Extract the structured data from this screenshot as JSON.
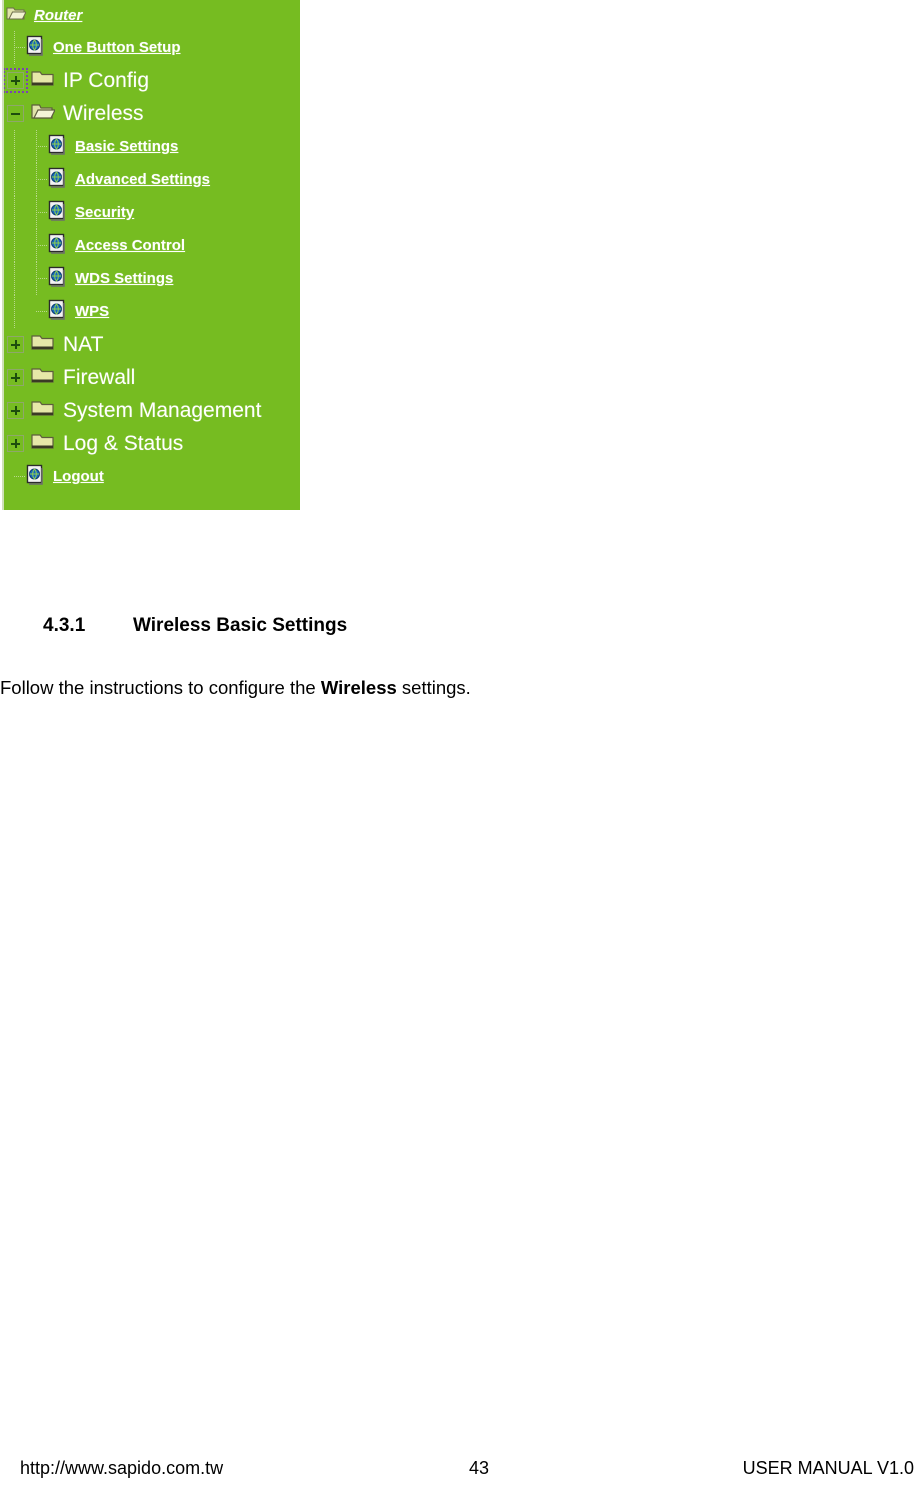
{
  "colors": {
    "nav_background": "#76bc21",
    "nav_label": "#ffffff",
    "page_background": "#ffffff",
    "text": "#000000",
    "focus_outline": "#7b42b5"
  },
  "nav_screenshot": {
    "root": {
      "label": "Router",
      "icon": "open-folder-icon"
    },
    "items": [
      {
        "label": "One Button Setup",
        "type": "link",
        "icon": "page-globe-icon",
        "depth": 1,
        "toggle": "none"
      },
      {
        "label": "IP Config",
        "type": "folder",
        "icon": "closed-folder-icon",
        "depth": 0,
        "toggle": "plus",
        "focused": true
      },
      {
        "label": "Wireless",
        "type": "folder",
        "icon": "open-folder-icon",
        "depth": 0,
        "toggle": "minus",
        "expanded": true
      },
      {
        "label": "Basic Settings",
        "type": "link",
        "icon": "page-globe-icon",
        "depth": 2,
        "toggle": "none"
      },
      {
        "label": "Advanced Settings",
        "type": "link",
        "icon": "page-globe-icon",
        "depth": 2,
        "toggle": "none"
      },
      {
        "label": "Security",
        "type": "link",
        "icon": "page-globe-icon",
        "depth": 2,
        "toggle": "none"
      },
      {
        "label": "Access Control",
        "type": "link",
        "icon": "page-globe-icon",
        "depth": 2,
        "toggle": "none"
      },
      {
        "label": "WDS Settings",
        "type": "link",
        "icon": "page-globe-icon",
        "depth": 2,
        "toggle": "none"
      },
      {
        "label": "WPS",
        "type": "link",
        "icon": "page-globe-icon",
        "depth": 2,
        "toggle": "none"
      },
      {
        "label": "NAT",
        "type": "folder",
        "icon": "closed-folder-icon",
        "depth": 0,
        "toggle": "plus"
      },
      {
        "label": "Firewall",
        "type": "folder",
        "icon": "closed-folder-icon",
        "depth": 0,
        "toggle": "plus"
      },
      {
        "label": "System Management",
        "type": "folder",
        "icon": "closed-folder-icon",
        "depth": 0,
        "toggle": "plus"
      },
      {
        "label": "Log & Status",
        "type": "folder",
        "icon": "closed-folder-icon",
        "depth": 0,
        "toggle": "plus"
      },
      {
        "label": "Logout",
        "type": "link",
        "icon": "page-globe-icon",
        "depth": 1,
        "toggle": "none"
      }
    ]
  },
  "document": {
    "heading": {
      "number": "4.3.1",
      "text": "Wireless Basic Settings"
    },
    "paragraph": {
      "before": "Follow the instructions to configure the ",
      "bold": "Wireless",
      "after": " settings."
    }
  },
  "footer": {
    "url": "http://www.sapido.com.tw",
    "page_number": "43",
    "manual": "USER MANUAL V1.0"
  }
}
